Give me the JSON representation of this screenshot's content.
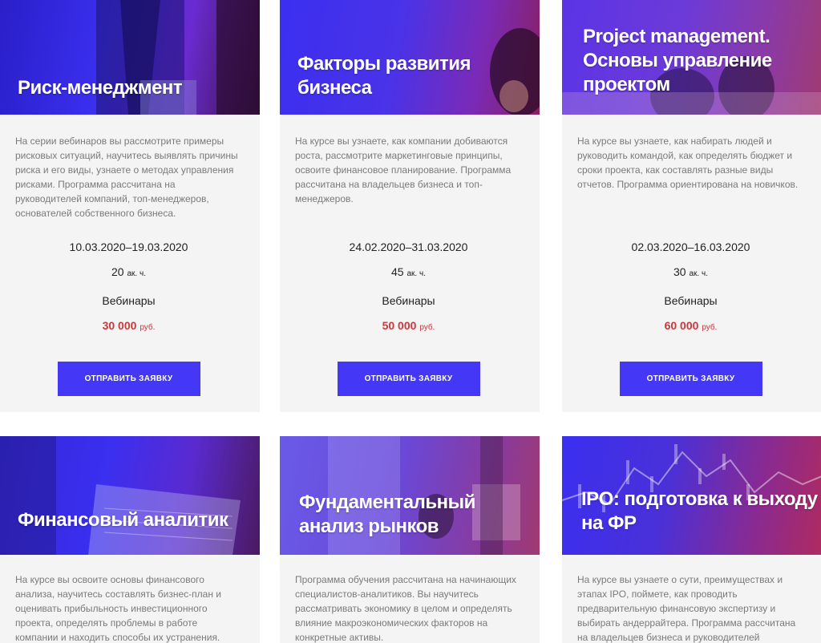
{
  "cards": [
    {
      "title": "Риск-менеджмент",
      "description": "На серии вебинаров вы рассмотрите примеры рисковых ситуаций, научитесь выявлять причины риска и его виды, узнаете о методах управления рисками. Программа рассчитана на руководителей компаний, топ-менеджеров, основателей собственного бизнеса.",
      "dates": "10.03.2020–19.03.2020",
      "hours": "20",
      "hours_unit": "ак. ч.",
      "format": "Вебинары",
      "price": "30 000",
      "price_unit": "руб.",
      "button": "ОТПРАВИТЬ ЗАЯВКУ"
    },
    {
      "title": "Факторы развития бизнеса",
      "description": "На курсе вы узнаете, как компании добиваются роста, рассмотрите маркетинговые принципы, освоите финансовое планирование. Программа рассчитана на владельцев бизнеса и топ-менеджеров.",
      "dates": "24.02.2020–31.03.2020",
      "hours": "45",
      "hours_unit": "ак. ч.",
      "format": "Вебинары",
      "price": "50 000",
      "price_unit": "руб.",
      "button": "ОТПРАВИТЬ ЗАЯВКУ"
    },
    {
      "title": "Project management. Основы управление проектом",
      "description": "На курсе вы узнаете, как набирать людей и руководить командой, как определять бюджет и сроки проекта, как составлять разные виды отчетов. Программа ориентирована на новичков.",
      "dates": "02.03.2020–16.03.2020",
      "hours": "30",
      "hours_unit": "ак. ч.",
      "format": "Вебинары",
      "price": "60 000",
      "price_unit": "руб.",
      "button": "ОТПРАВИТЬ ЗАЯВКУ"
    },
    {
      "title": "Финансовый аналитик",
      "description": "На курсе вы освоите основы финансового анализа, научитесь составлять бизнес-план и оценивать прибыльность инвестиционного проекта, определять проблемы в работе компании и находить способы их устранения."
    },
    {
      "title": "Фундаментальный анализ рынков",
      "description": "Программа обучения рассчитана на начинающих специалистов-аналитиков. Вы научитесь рассматривать экономику в целом и определять влияние макроэкономических факторов на конкретные активы."
    },
    {
      "title": "IPO: подготовка к выходу на ФР",
      "description": "На курсе вы узнаете о сути, преимуществах и этапах IPO, поймете, как проводить предварительную финансовую экспертизу и выбирать андеррайтера. Программа рассчитана на владельцев бизнеса и руководителей"
    }
  ],
  "colors": {
    "accent": "#4438f6",
    "price": "#c9393a",
    "card_bg": "#f4f4f5",
    "overlay_blue": "#3b2ff0",
    "overlay_magenta": "#a0287a"
  }
}
